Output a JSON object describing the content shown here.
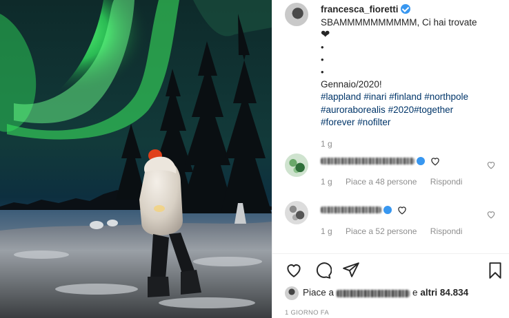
{
  "post": {
    "username": "francesca_fioretti",
    "caption_text": "SBAMMMMMMMMMM, Ci hai trovate",
    "caption_heart": "❤",
    "caption_dots": [
      "•",
      "•",
      "•"
    ],
    "caption_date": "Gennaio/2020!",
    "hashtag_rows": [
      [
        "#lappland",
        "#inari",
        "#finland",
        "#northpole"
      ],
      [
        "#auroraborealis",
        "#2020#together"
      ],
      [
        "#forever",
        "#nofilter"
      ]
    ],
    "time_ago": "1 g"
  },
  "comments": [
    {
      "time": "1 g",
      "likes_text": "Piace a 48 persone",
      "reply_label": "Rispondi"
    },
    {
      "time": "1 g",
      "likes_text": "Piace a 52 persone",
      "reply_label": "Rispondi"
    }
  ],
  "likes": {
    "prefix": "Piace a",
    "others_connector": "e",
    "others_text": "altri 84.834"
  },
  "posted_label": "1 GIORNO FA",
  "icons": {
    "verified": "verified-badge-icon",
    "like": "heart-outline-icon",
    "comment": "comment-bubble-icon",
    "share": "paper-plane-icon",
    "save": "bookmark-icon"
  },
  "colors": {
    "accent": "#3897f0",
    "hashtag": "#003569",
    "muted": "#8e8e8e",
    "aurora": "#3ee86a"
  }
}
